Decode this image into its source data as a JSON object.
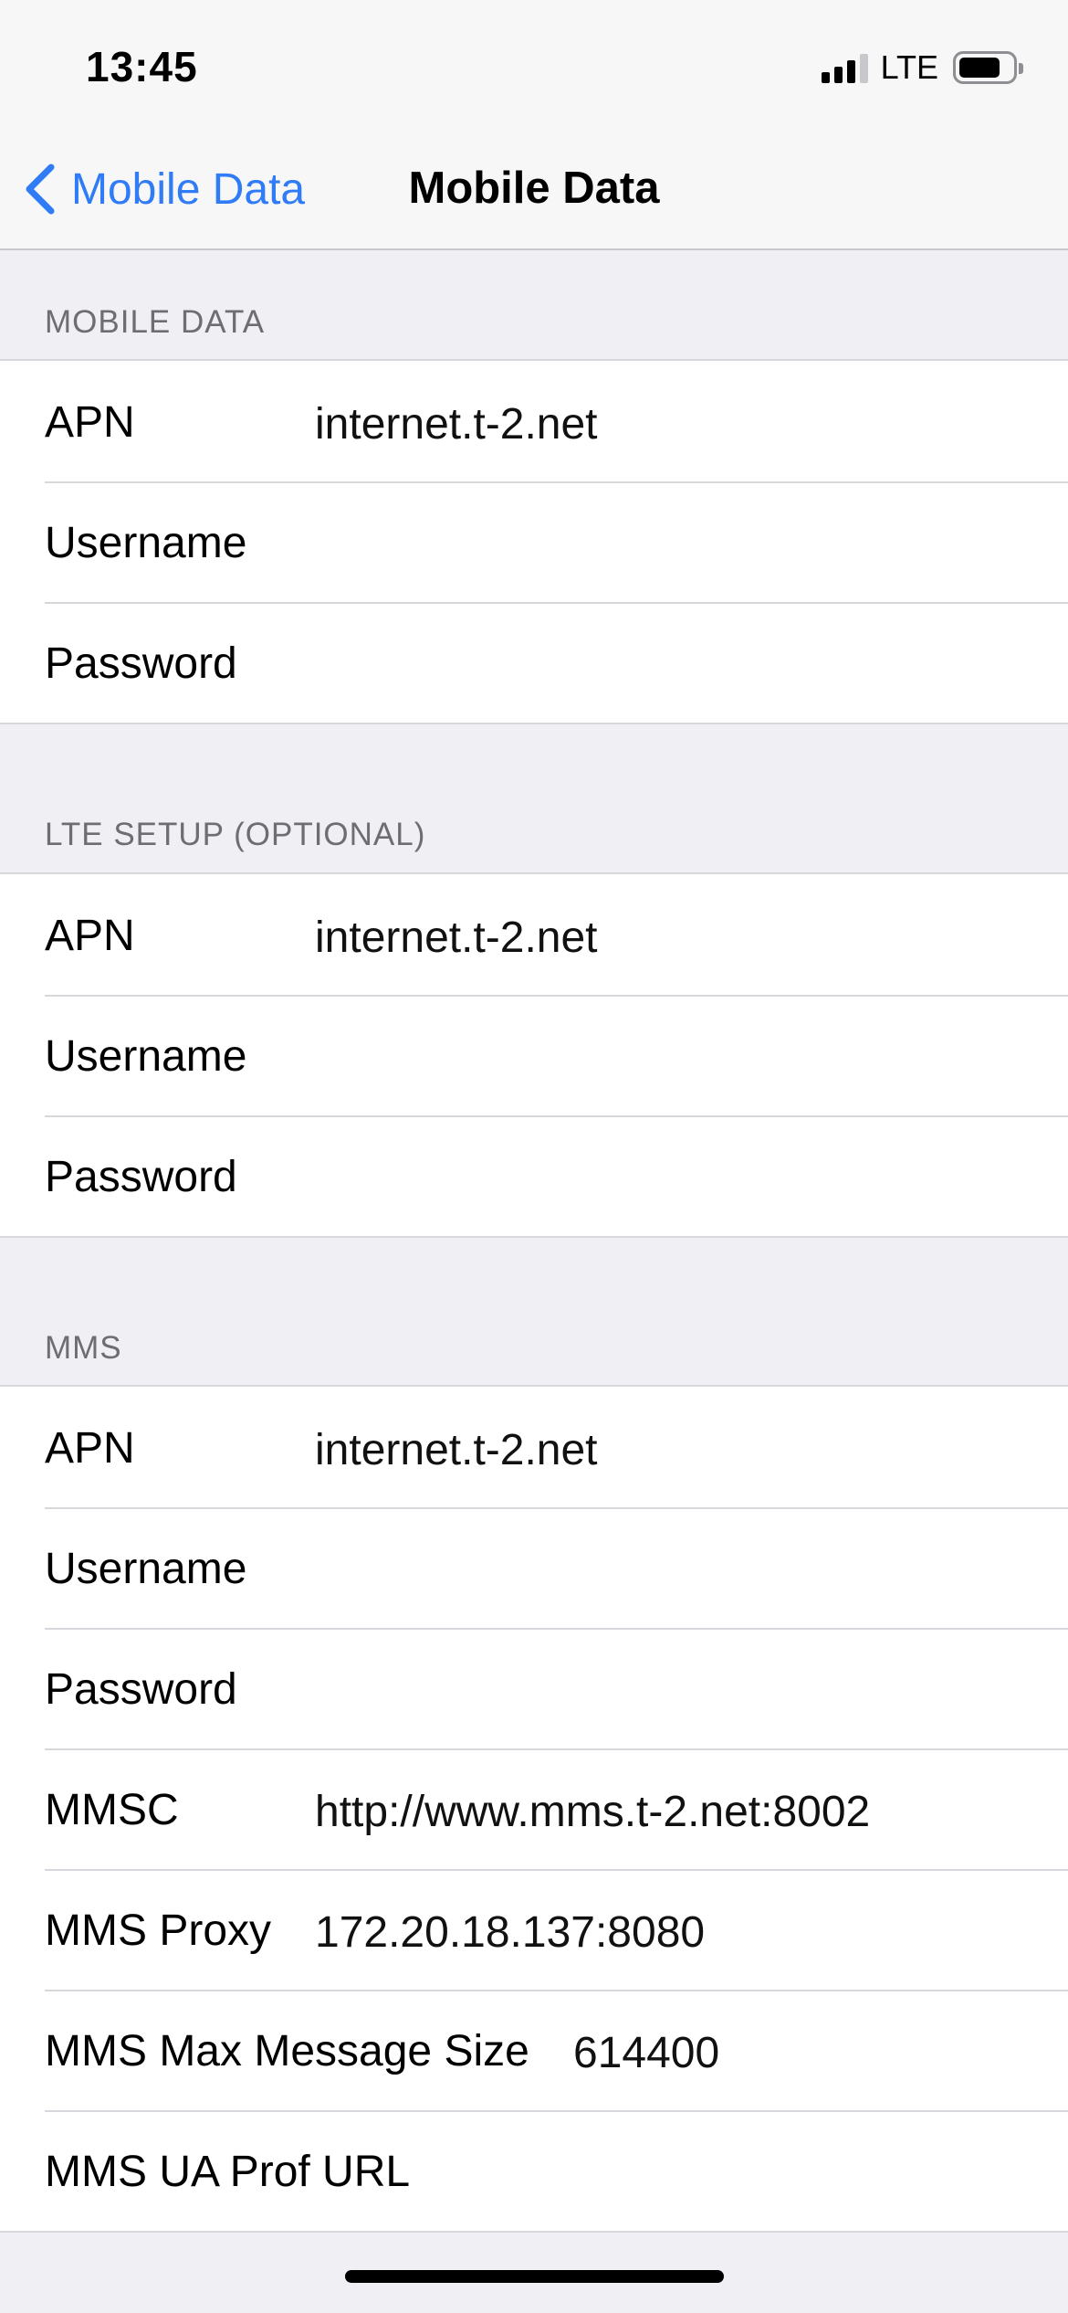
{
  "status_bar": {
    "time": "13:45",
    "network": "LTE"
  },
  "nav": {
    "back_label": "Mobile Data",
    "title": "Mobile Data"
  },
  "sections": [
    {
      "header": "MOBILE DATA",
      "rows": [
        {
          "label": "APN",
          "value": "internet.t-2.net"
        },
        {
          "label": "Username",
          "value": ""
        },
        {
          "label": "Password",
          "value": ""
        }
      ]
    },
    {
      "header": "LTE SETUP (OPTIONAL)",
      "rows": [
        {
          "label": "APN",
          "value": "internet.t-2.net"
        },
        {
          "label": "Username",
          "value": ""
        },
        {
          "label": "Password",
          "value": ""
        }
      ]
    },
    {
      "header": "MMS",
      "rows": [
        {
          "label": "APN",
          "value": "internet.t-2.net"
        },
        {
          "label": "Username",
          "value": ""
        },
        {
          "label": "Password",
          "value": ""
        },
        {
          "label": "MMSC",
          "value": "http://www.mms.t-2.net:8002"
        },
        {
          "label": "MMS Proxy",
          "value": "172.20.18.137:8080"
        },
        {
          "label": "MMS Max Message Size",
          "value": "614400"
        },
        {
          "label": "MMS UA Prof URL",
          "value": ""
        }
      ]
    }
  ],
  "colors": {
    "accent": "#2f7cf6",
    "background": "#efeff4",
    "section_header": "#6d6d72"
  }
}
